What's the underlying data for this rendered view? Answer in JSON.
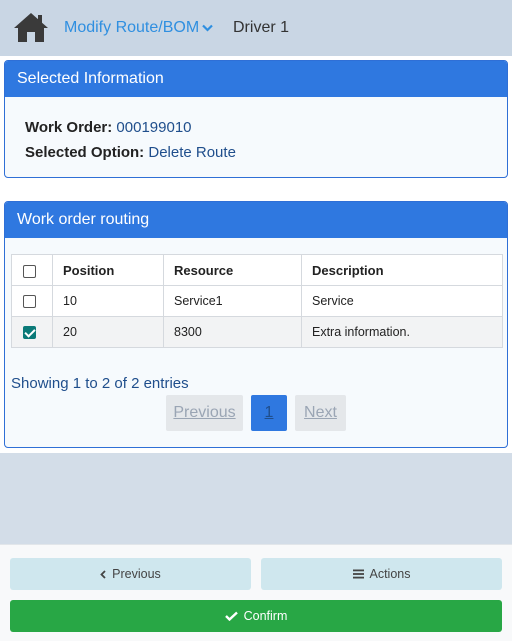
{
  "header": {
    "menu_label": "Modify Route/BOM",
    "driver": "Driver 1"
  },
  "selected": {
    "heading": "Selected Information",
    "work_order_label": "Work Order:",
    "work_order_value": "000199010",
    "option_label": "Selected Option:",
    "option_value": "Delete Route"
  },
  "routing": {
    "heading": "Work order routing",
    "columns": [
      "Position",
      "Resource",
      "Description"
    ],
    "rows": [
      {
        "position": "10",
        "resource": "Service1",
        "description": "Service",
        "checked": false
      },
      {
        "position": "20",
        "resource": "8300",
        "description": "Extra information.",
        "checked": true
      }
    ],
    "entries": "Showing 1 to 2 of 2 entries",
    "pager": {
      "previous": "Previous",
      "page": "1",
      "next": "Next"
    }
  },
  "footer": {
    "previous": "Previous",
    "actions": "Actions",
    "confirm": "Confirm"
  },
  "colors": {
    "accent": "#2f78e0",
    "confirm": "#28a745",
    "secondary_button": "#cfe7ee"
  }
}
